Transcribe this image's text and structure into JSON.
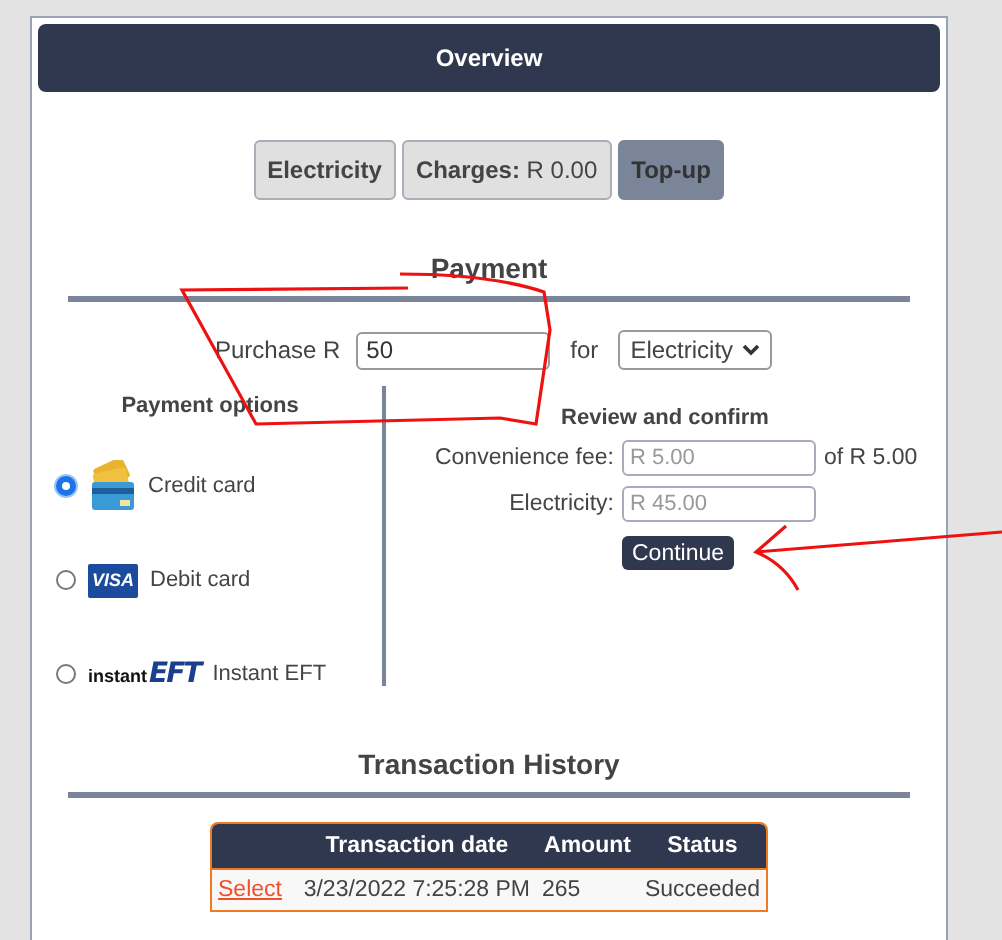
{
  "header": {
    "title": "Overview"
  },
  "tabs": [
    {
      "label": "Electricity",
      "selected": false
    },
    {
      "label": "**Charges:** R 0.00",
      "selected": false
    },
    {
      "label": "Top-up",
      "selected": true
    }
  ],
  "payment": {
    "title": "Payment",
    "purchase_label": "Purchase R",
    "amount": "50",
    "for_label": "for",
    "product": "Electricity"
  },
  "payment_options": {
    "title": "Payment options",
    "items": [
      {
        "label": "Credit card",
        "kind": "cards",
        "selected": true
      },
      {
        "label": "Debit card",
        "kind": "visa",
        "logo": "VISA",
        "selected": false
      },
      {
        "label": "Instant EFT",
        "kind": "eft",
        "logo": [
          "instant",
          "EFT"
        ],
        "selected": false
      }
    ]
  },
  "review": {
    "title": "Review and confirm",
    "fields": [
      {
        "label": "Convenience fee:",
        "placeholder": "R 5.00",
        "suffix": "of R 5.00"
      },
      {
        "label": "Electricity:",
        "placeholder": "R 45.00"
      }
    ],
    "button": "Continue"
  },
  "history": {
    "title": "Transaction History",
    "columns": [
      "Transaction date",
      "Amount",
      "Status"
    ],
    "rows": [
      {
        "action": "Select",
        "date": "3/23/2022 7:25:28 PM",
        "amount": "265",
        "status": "Succeeded"
      }
    ]
  }
}
